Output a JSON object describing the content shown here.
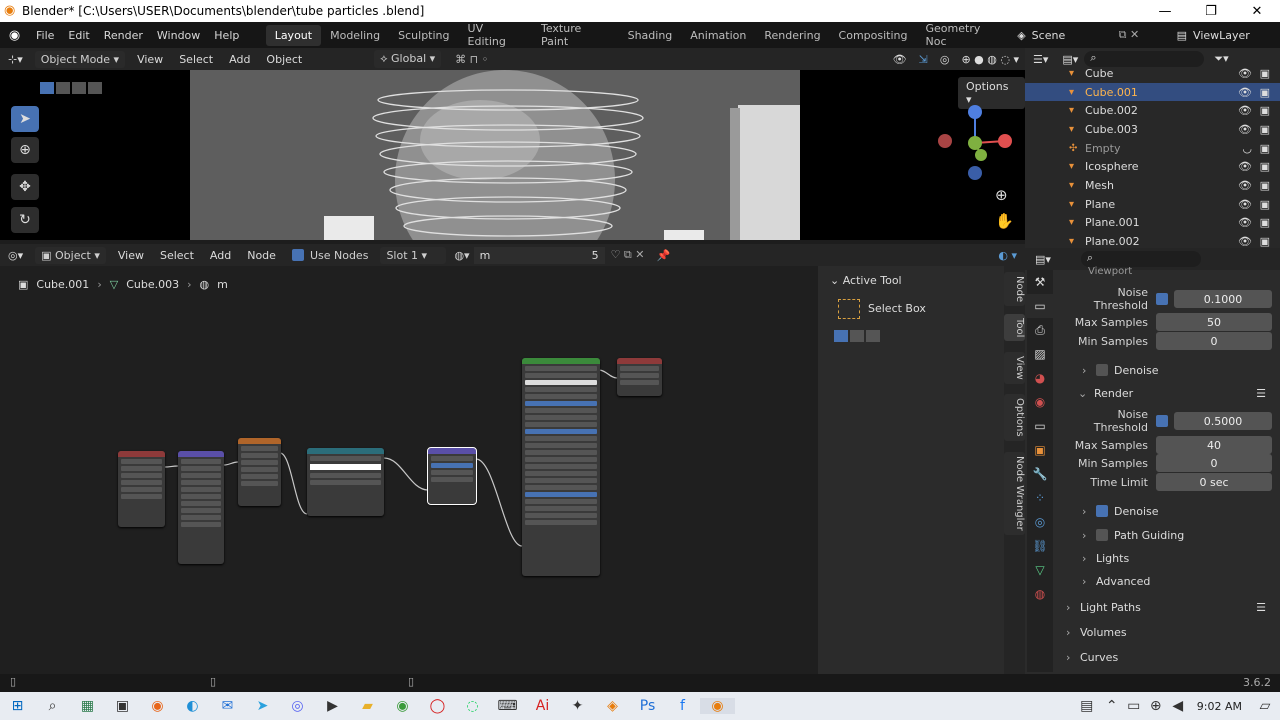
{
  "window": {
    "title": "Blender* [C:\\Users\\USER\\Documents\\blender\\tube particles .blend]",
    "minimize": "—",
    "maximize": "❐",
    "close": "✕"
  },
  "menu": {
    "items": [
      "File",
      "Edit",
      "Render",
      "Window",
      "Help"
    ]
  },
  "workspaces": {
    "tabs": [
      "Layout",
      "Modeling",
      "Sculpting",
      "UV Editing",
      "Texture Paint",
      "Shading",
      "Animation",
      "Rendering",
      "Compositing",
      "Geometry Noc"
    ],
    "active": "Layout"
  },
  "scene": {
    "name": "Scene",
    "view_layer": "ViewLayer"
  },
  "viewport": {
    "mode": "Object Mode",
    "menus": [
      "View",
      "Select",
      "Add",
      "Object"
    ],
    "orientation": "Global",
    "options_label": "Options"
  },
  "node_editor": {
    "type": "Object",
    "menus": [
      "View",
      "Select",
      "Add",
      "Node"
    ],
    "use_nodes_label": "Use Nodes",
    "slot": "Slot 1",
    "material": "m",
    "users": "5"
  },
  "breadcrumb": {
    "object": "Cube.001",
    "mesh": "Cube.003",
    "material": "m"
  },
  "sidebar": {
    "panel_title": "Active Tool",
    "tool_name": "Select Box",
    "tabs": [
      "Node",
      "Tool",
      "View",
      "Options",
      "Node Wrangler"
    ]
  },
  "outliner": {
    "rows": [
      {
        "name": "Cube",
        "selected": false,
        "dim": false
      },
      {
        "name": "Cube.001",
        "selected": true,
        "dim": false
      },
      {
        "name": "Cube.002",
        "selected": false,
        "dim": false
      },
      {
        "name": "Cube.003",
        "selected": false,
        "dim": false
      },
      {
        "name": "Empty",
        "selected": false,
        "dim": true
      },
      {
        "name": "Icosphere",
        "selected": false,
        "dim": false
      },
      {
        "name": "Mesh",
        "selected": false,
        "dim": false
      },
      {
        "name": "Plane",
        "selected": false,
        "dim": false
      },
      {
        "name": "Plane.001",
        "selected": false,
        "dim": false
      },
      {
        "name": "Plane.002",
        "selected": false,
        "dim": false
      }
    ]
  },
  "properties": {
    "viewport_section": "Viewport",
    "vp_noise_threshold_label": "Noise Threshold",
    "vp_noise_threshold": "0.1000",
    "vp_max_samples_label": "Max Samples",
    "vp_max_samples": "50",
    "vp_min_samples_label": "Min Samples",
    "vp_min_samples": "0",
    "vp_denoise_label": "Denoise",
    "render_section": "Render",
    "r_noise_threshold_label": "Noise Threshold",
    "r_noise_threshold": "0.5000",
    "r_max_samples_label": "Max Samples",
    "r_max_samples": "40",
    "r_min_samples_label": "Min Samples",
    "r_min_samples": "0",
    "r_time_limit_label": "Time Limit",
    "r_time_limit": "0 sec",
    "r_denoise_label": "Denoise",
    "path_guiding_label": "Path Guiding",
    "lights_label": "Lights",
    "advanced_label": "Advanced",
    "light_paths_label": "Light Paths",
    "volumes_label": "Volumes",
    "curves_label": "Curves"
  },
  "status": {
    "version": "3.6.2"
  },
  "taskbar": {
    "time": "9:02 AM"
  }
}
